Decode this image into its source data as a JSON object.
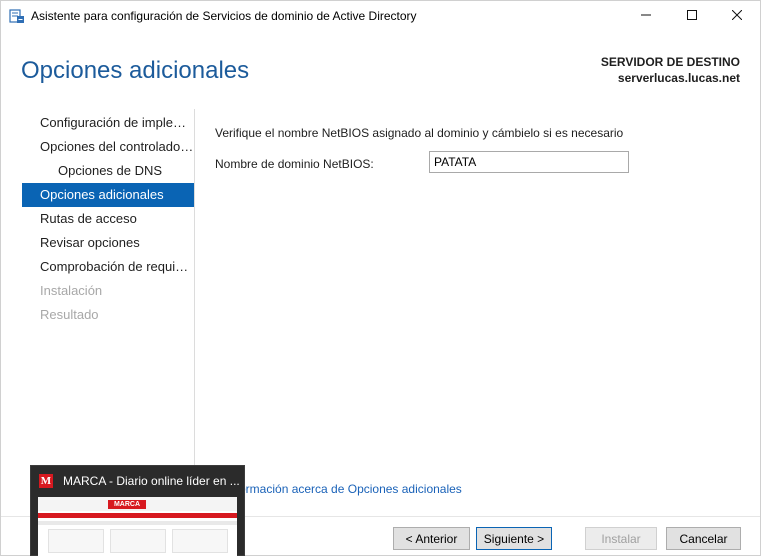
{
  "window": {
    "title": "Asistente para configuración de Servicios de dominio de Active Directory",
    "icon": "server-wizard-icon",
    "controls": [
      "minimize-icon",
      "maximize-icon",
      "close-icon"
    ]
  },
  "header": {
    "page_title": "Opciones adicionales",
    "destination_label": "SERVIDOR DE DESTINO",
    "destination_value": "serverlucas.lucas.net"
  },
  "nav": {
    "items": [
      {
        "label": "Configuración de implem...",
        "state": "normal"
      },
      {
        "label": "Opciones del controlador...",
        "state": "normal"
      },
      {
        "label": "Opciones de DNS",
        "state": "sub"
      },
      {
        "label": "Opciones adicionales",
        "state": "active"
      },
      {
        "label": "Rutas de acceso",
        "state": "normal"
      },
      {
        "label": "Revisar opciones",
        "state": "normal"
      },
      {
        "label": "Comprobación de requisi...",
        "state": "normal"
      },
      {
        "label": "Instalación",
        "state": "disabled"
      },
      {
        "label": "Resultado",
        "state": "disabled"
      }
    ]
  },
  "content": {
    "verify_text": "Verifique el nombre NetBIOS asignado al dominio y cámbielo si es necesario",
    "netbios_label": "Nombre de dominio NetBIOS:",
    "netbios_value": "PATATA",
    "more_info_link": "nformación acerca de Opciones adicionales"
  },
  "footer": {
    "prev_label": "< Anterior",
    "next_label": "Siguiente >",
    "install_label": "Instalar",
    "cancel_label": "Cancelar"
  },
  "taskbar_thumbnail": {
    "title": "MARCA - Diario online líder en ...",
    "icon_letter": "M",
    "logo_text": "MARCA"
  },
  "colors": {
    "accent": "#0a64b4",
    "title_blue": "#1c5b9b",
    "link": "#1a62b8",
    "marca_red": "#d71920"
  }
}
